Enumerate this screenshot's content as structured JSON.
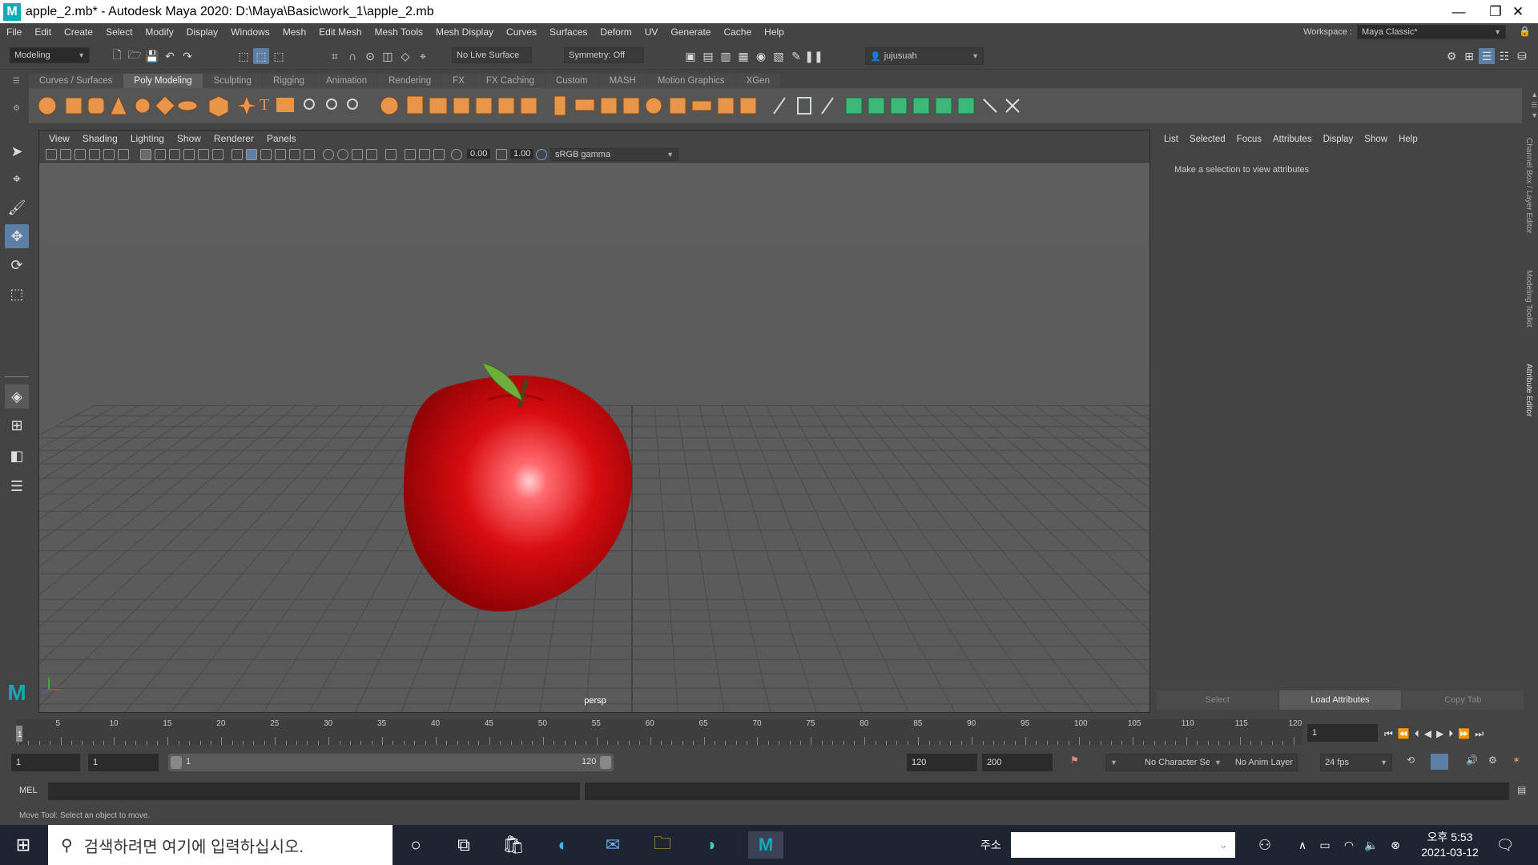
{
  "window": {
    "title": "apple_2.mb* - Autodesk Maya 2020: D:\\Maya\\Basic\\work_1\\apple_2.mb",
    "logo_letter": "M"
  },
  "menu": [
    "File",
    "Edit",
    "Create",
    "Select",
    "Modify",
    "Display",
    "Windows",
    "Mesh",
    "Edit Mesh",
    "Mesh Tools",
    "Mesh Display",
    "Curves",
    "Surfaces",
    "Deform",
    "UV",
    "Generate",
    "Cache",
    "Help"
  ],
  "workspace": {
    "label": "Workspace :",
    "value": "Maya Classic*"
  },
  "status_line": {
    "menu_set": "Modeling",
    "live_surface": "No Live Surface",
    "symmetry": "Symmetry: Off",
    "user": "jujusuah"
  },
  "shelf_tabs": [
    "Curves / Surfaces",
    "Poly Modeling",
    "Sculpting",
    "Rigging",
    "Animation",
    "Rendering",
    "FX",
    "FX Caching",
    "Custom",
    "MASH",
    "Motion Graphics",
    "XGen"
  ],
  "shelf_active": "Poly Modeling",
  "viewport": {
    "menu": [
      "View",
      "Shading",
      "Lighting",
      "Show",
      "Renderer",
      "Panels"
    ],
    "exposure": "0.00",
    "gamma": "1.00",
    "color_space": "sRGB gamma",
    "camera": "persp",
    "apple_color": "#d80c10",
    "stem_color": "#5a3a1a",
    "leaf_color": "#6fae3a"
  },
  "attribute_editor": {
    "menu": [
      "List",
      "Selected",
      "Focus",
      "Attributes",
      "Display",
      "Show",
      "Help"
    ],
    "message": "Make a selection to view attributes",
    "buttons": {
      "select": "Select",
      "load": "Load Attributes",
      "copy": "Copy Tab"
    }
  },
  "side_tabs": [
    "Channel Box / Layer Editor",
    "Modeling Toolkit",
    "Attribute Editor"
  ],
  "timeline": {
    "ticks": [
      "5",
      "10",
      "15",
      "20",
      "25",
      "30",
      "35",
      "40",
      "45",
      "50",
      "55",
      "60",
      "65",
      "70",
      "75",
      "80",
      "85",
      "90",
      "95",
      "100",
      "105",
      "110",
      "115",
      "120"
    ],
    "current_frame": "1",
    "start_label": "1"
  },
  "range": {
    "start": "1",
    "playback_start": "1",
    "slider_start": "1",
    "slider_end": "120",
    "playback_end": "120",
    "end": "200",
    "character_set": "No Character Set",
    "anim_layer": "No Anim Layer",
    "fps": "24 fps"
  },
  "command_line": {
    "label": "MEL"
  },
  "help_line": "Move Tool: Select an object to move.",
  "taskbar": {
    "search_placeholder": "검색하려면 여기에 입력하십시오.",
    "address_label": "주소",
    "time": "오후 5:53",
    "date": "2021-03-12"
  }
}
